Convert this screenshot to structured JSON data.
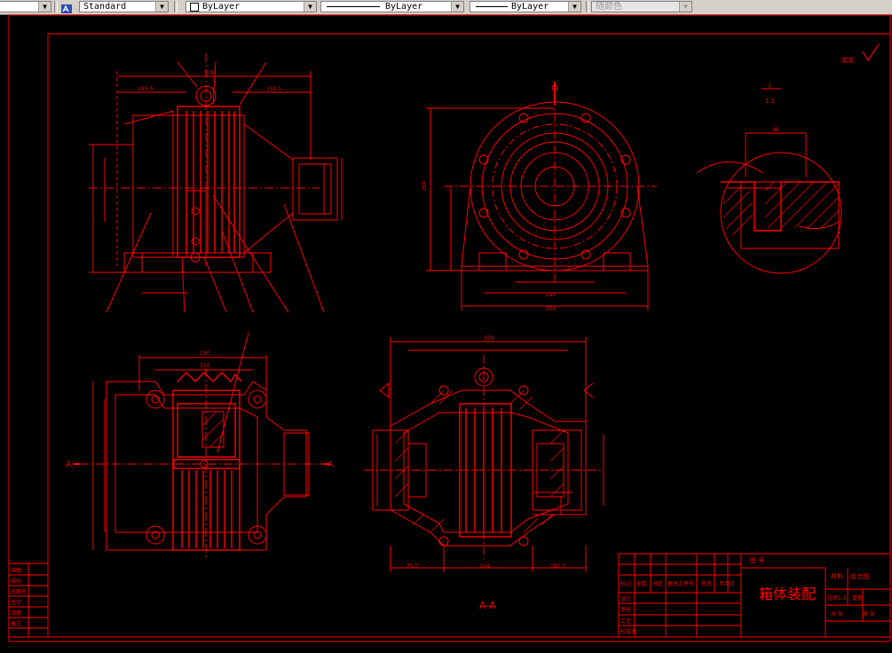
{
  "toolbar": {
    "text_style": "Standard",
    "layer": "ByLayer",
    "linetype": "ByLayer",
    "lineweight": "ByLayer",
    "plot_style": "随颜色"
  },
  "drawing": {
    "title": "箱体装配",
    "section_label": "A-A",
    "detail_label": "I",
    "detail_scale": "1:1",
    "view_mark_left": "A",
    "view_mark_right": "A",
    "surface_note": "其余",
    "tb_material_label": "材料",
    "tb_material_value": "组合图",
    "tb_scale_label": "比例1:3",
    "tb_sheet_total": "共 张",
    "tb_sheet_no": "第 张",
    "tb_fig_code": "图 号",
    "tb_col_headers": [
      "标记",
      "处数",
      "分区",
      "更改文件号",
      "签名",
      "年月日"
    ],
    "tb_row_labels": [
      "设计",
      "审核",
      "工艺",
      "标准化"
    ],
    "tb_weight_label": "重量",
    "left_strip_labels": [
      "描图",
      "描校",
      "底图号",
      "签字",
      "日期",
      "备注"
    ],
    "dims": {
      "top_overall": "378",
      "top_left": "185.5",
      "top_right": "132.5",
      "side_total": "260",
      "side_width": "350",
      "side_base": "220",
      "section_width": "370",
      "section_bottom_left": "75.5",
      "section_bottom_mid": "204",
      "section_bottom_right": "182.5",
      "plan_total": "280",
      "plan_inner": "250",
      "detail_width": "40"
    }
  }
}
